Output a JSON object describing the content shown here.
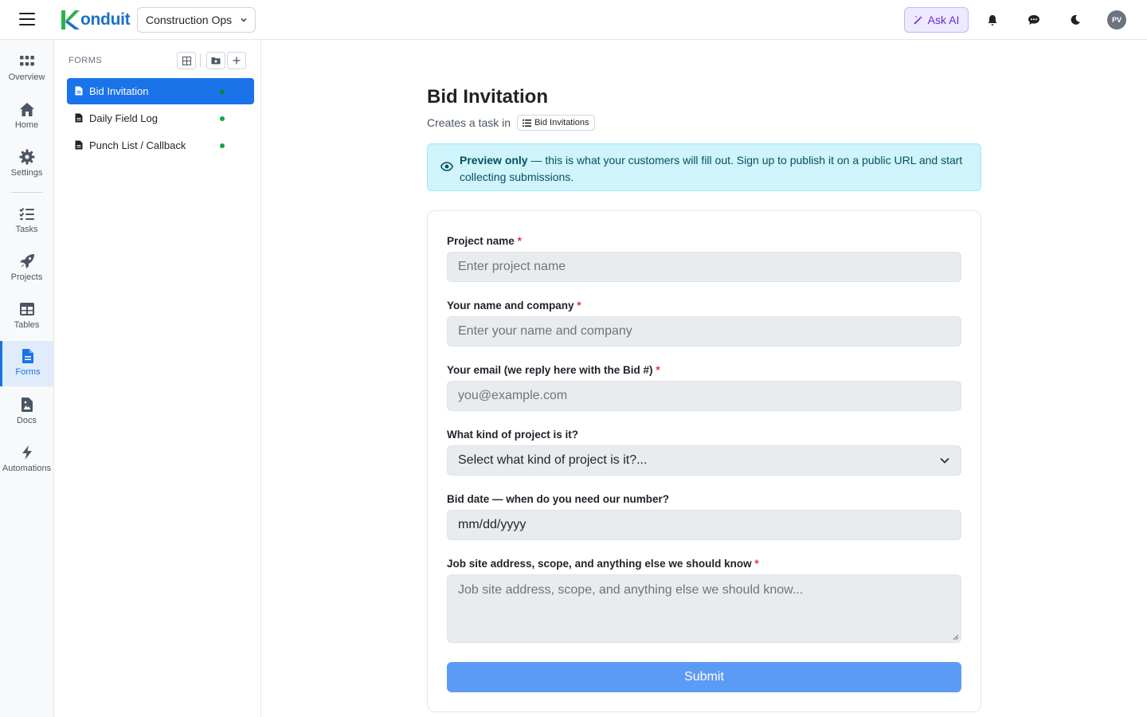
{
  "app": {
    "logo_text": "onduit",
    "workspace": "Construction Ops",
    "ask_ai_label": "Ask AI",
    "avatar_initials": "PV",
    "brand_color": "#1d70c9",
    "accent_color": "#1a73e8"
  },
  "nav": {
    "items": [
      {
        "label": "Overview",
        "icon": "grid-dots-icon"
      },
      {
        "label": "Home",
        "icon": "home-icon"
      },
      {
        "label": "Settings",
        "icon": "gear-icon"
      },
      {
        "label": "Tasks",
        "icon": "tasks-list-icon"
      },
      {
        "label": "Projects",
        "icon": "rocket-icon"
      },
      {
        "label": "Tables",
        "icon": "table-icon"
      },
      {
        "label": "Forms",
        "icon": "form-document-icon",
        "active": true
      },
      {
        "label": "Docs",
        "icon": "docs-icon"
      },
      {
        "label": "Automations",
        "icon": "lightning-icon"
      }
    ]
  },
  "forms_panel": {
    "title": "FORMS",
    "items": [
      {
        "label": "Bid Invitation",
        "active": true
      },
      {
        "label": "Daily Field Log"
      },
      {
        "label": "Punch List / Callback"
      }
    ]
  },
  "main": {
    "title": "Bid Invitation",
    "creates_task_text": "Creates a task in",
    "task_table_chip": "Bid Invitations",
    "banner": {
      "bold": "Preview only",
      "text": " — this is what your customers will fill out. Sign up to publish it on a public URL and start collecting submissions."
    },
    "fields": [
      {
        "label": "Project name",
        "required": true,
        "placeholder": "Enter project name",
        "type": "text"
      },
      {
        "label": "Your name and company",
        "required": true,
        "placeholder": "Enter your name and company",
        "type": "text"
      },
      {
        "label": "Your email (we reply here with the Bid #)",
        "required": true,
        "placeholder": "you@example.com",
        "type": "email"
      },
      {
        "label": "What kind of project is it?",
        "required": false,
        "placeholder": "Select what kind of project is it?...",
        "type": "select"
      },
      {
        "label": "Bid date — when do you need our number?",
        "required": false,
        "placeholder": "mm/dd/yyyy",
        "type": "date"
      },
      {
        "label": "Job site address, scope, and anything else we should know",
        "required": true,
        "placeholder": "Job site address, scope, and anything else we should know...",
        "type": "textarea"
      }
    ],
    "required_marker": "*",
    "submit_label": "Submit"
  }
}
